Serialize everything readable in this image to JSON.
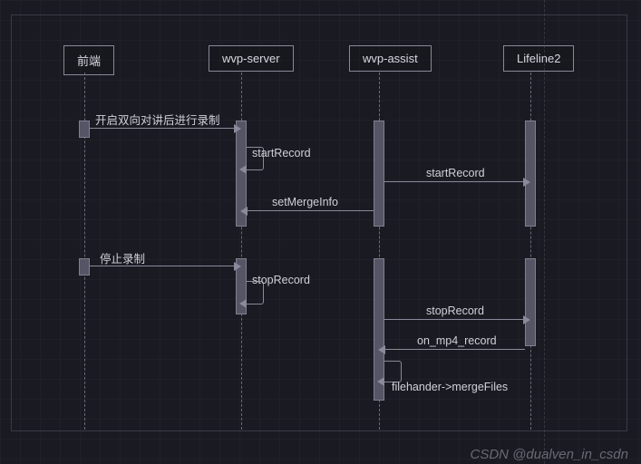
{
  "participants": {
    "p1": "前端",
    "p2": "wvp-server",
    "p3": "wvp-assist",
    "p4": "Lifeline2"
  },
  "messages": {
    "m1": "开启双向对讲后进行录制",
    "m2": "startRecord",
    "m3": "startRecord",
    "m4": "setMergeInfo",
    "m5": "停止录制",
    "m6": "stopRecord",
    "m7": "stopRecord",
    "m8": "on_mp4_record",
    "m9": "filehander->mergeFiles"
  },
  "watermark": "CSDN @dualven_in_csdn",
  "chart_data": {
    "type": "sequence-diagram",
    "participants": [
      "前端",
      "wvp-server",
      "wvp-assist",
      "Lifeline2"
    ],
    "interactions": [
      {
        "from": "前端",
        "to": "wvp-server",
        "label": "开启双向对讲后进行录制",
        "kind": "sync"
      },
      {
        "from": "wvp-server",
        "to": "wvp-server",
        "label": "startRecord",
        "kind": "self"
      },
      {
        "from": "wvp-assist",
        "to": "Lifeline2",
        "label": "startRecord",
        "kind": "sync"
      },
      {
        "from": "wvp-assist",
        "to": "wvp-server",
        "label": "setMergeInfo",
        "kind": "sync"
      },
      {
        "from": "前端",
        "to": "wvp-server",
        "label": "停止录制",
        "kind": "sync"
      },
      {
        "from": "wvp-server",
        "to": "wvp-server",
        "label": "stopRecord",
        "kind": "self"
      },
      {
        "from": "wvp-assist",
        "to": "Lifeline2",
        "label": "stopRecord",
        "kind": "sync"
      },
      {
        "from": "Lifeline2",
        "to": "wvp-assist",
        "label": "on_mp4_record",
        "kind": "sync"
      },
      {
        "from": "wvp-assist",
        "to": "wvp-assist",
        "label": "filehander->mergeFiles",
        "kind": "self"
      }
    ]
  }
}
